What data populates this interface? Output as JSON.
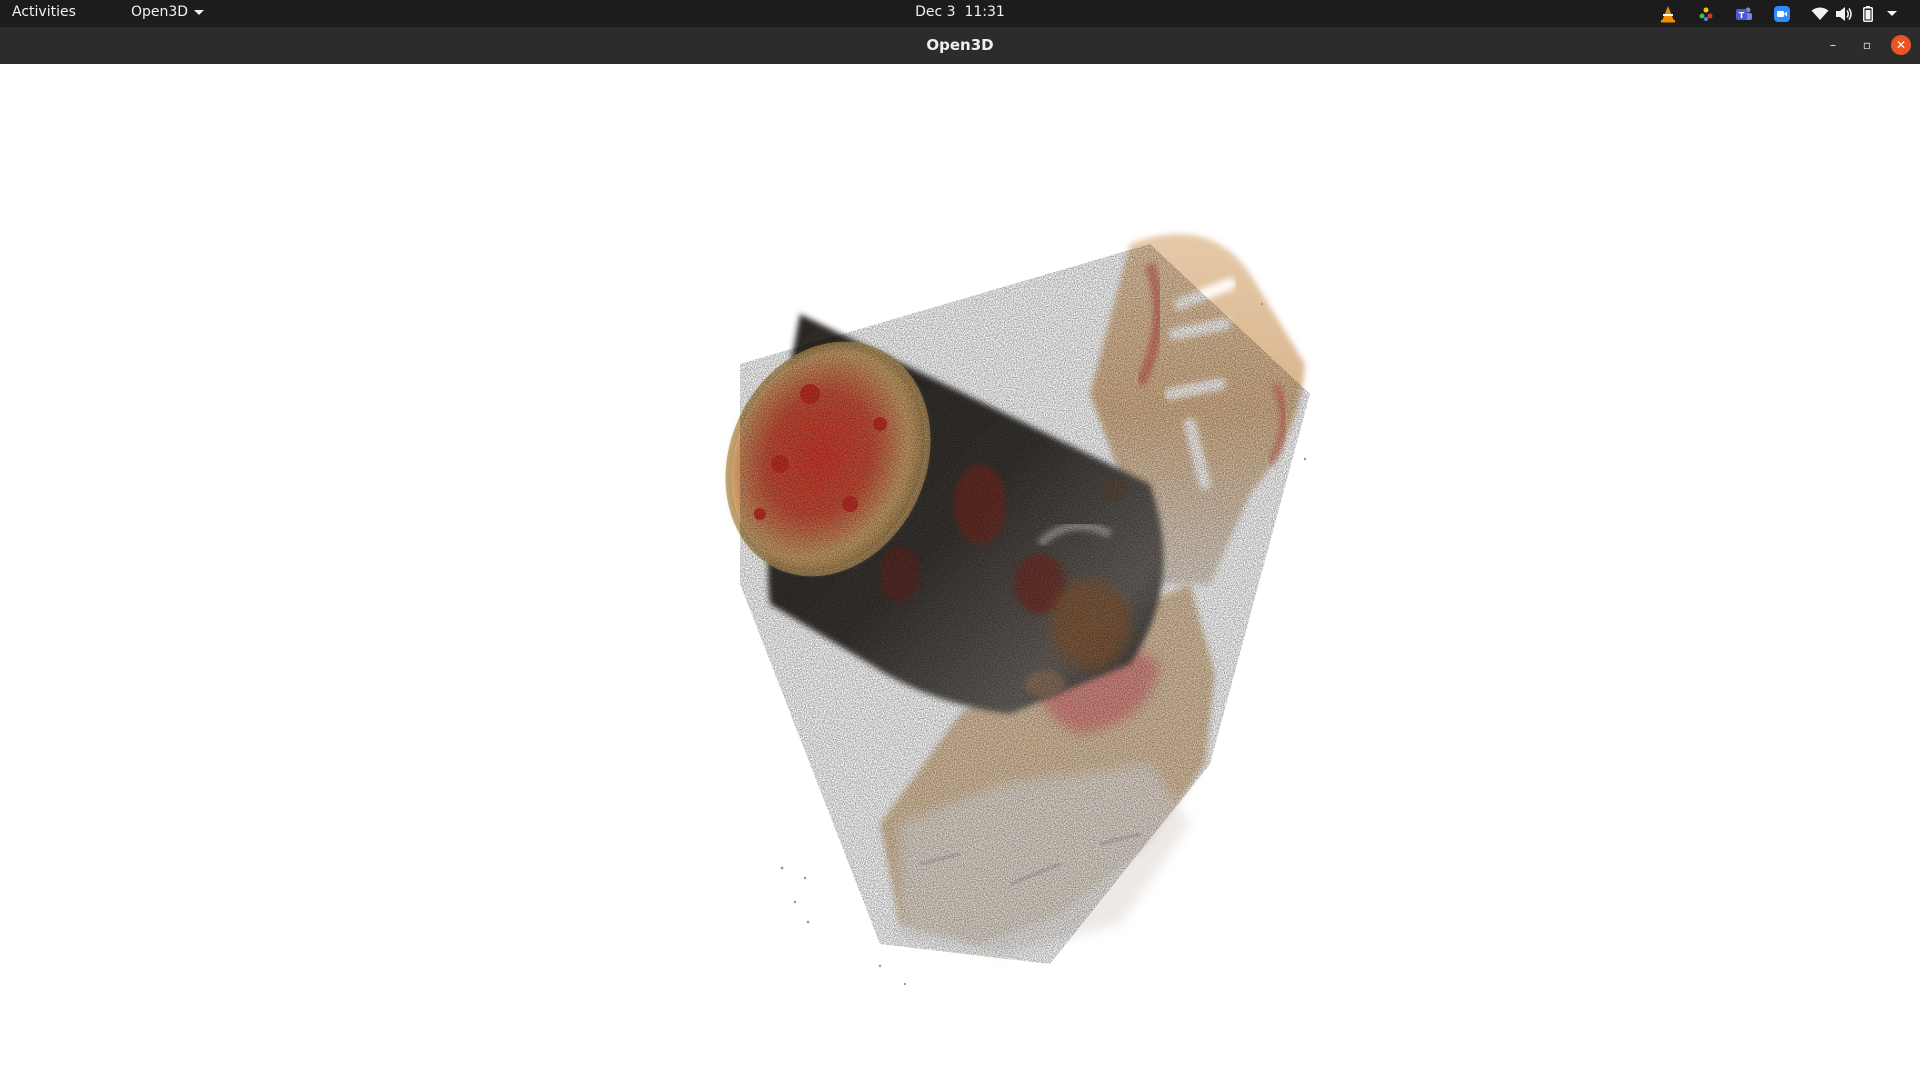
{
  "topbar": {
    "activities_label": "Activities",
    "app_menu_label": "Open3D",
    "clock": "Dec 3  11:31"
  },
  "window": {
    "title": "Open3D",
    "minimize_glyph": "–",
    "maximize_glyph": "▫",
    "close_glyph": "✕"
  },
  "tray_icons": [
    "vlc-icon",
    "color-picker-icon",
    "teams-icon",
    "zoom-icon",
    "wifi-icon",
    "volume-icon",
    "battery-icon",
    "system-menu-caret-icon"
  ],
  "colors": {
    "topbar_bg": "#1c1c1c",
    "titlebar_bg": "#2c2c2c",
    "close_button": "#e95420",
    "viewport_bg": "#ffffff"
  }
}
